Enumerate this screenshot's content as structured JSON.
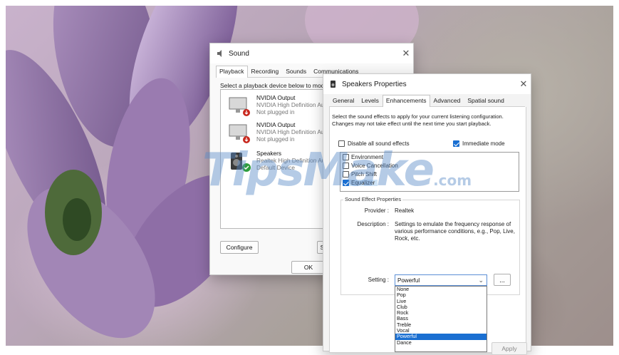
{
  "sound_window": {
    "title": "Sound",
    "close": "✕",
    "tabs": [
      "Playback",
      "Recording",
      "Sounds",
      "Communications"
    ],
    "hint": "Select a playback device below to modi",
    "devices": [
      {
        "name": "NVIDIA Output",
        "line1": "NVIDIA High Definition Au",
        "line2": "Not plugged in"
      },
      {
        "name": "NVIDIA Output",
        "line1": "NVIDIA High Definition Au",
        "line2": "Not plugged in"
      },
      {
        "name": "Speakers",
        "line1": "Realtek High Definition Au",
        "line2": "Default Device"
      }
    ],
    "configure_label": "Configure",
    "set_label": "S",
    "ok_label": "OK"
  },
  "speakers_window": {
    "title": "Speakers Properties",
    "close": "✕",
    "tabs": [
      "General",
      "Levels",
      "Enhancements",
      "Advanced",
      "Spatial sound"
    ],
    "instructions": "Select the sound effects to apply for your current listening configuration. Changes may not take effect until the next time you start playback.",
    "disable_all_label": "Disable all sound effects",
    "disable_all_checked": false,
    "immediate_mode_label": "Immediate mode",
    "immediate_mode_checked": true,
    "effects": [
      {
        "label": "Environment",
        "checked": false
      },
      {
        "label": "Voice Cancellation",
        "checked": false
      },
      {
        "label": "Pitch Shift",
        "checked": false
      },
      {
        "label": "Equalizer",
        "checked": true
      }
    ],
    "properties_title": "Sound Effect Properties",
    "provider_label": "Provider :",
    "provider_value": "Realtek",
    "description_label": "Description :",
    "description_value": "Settings to emulate the frequency response of various performance conditions, e.g., Pop, Live, Rock, etc.",
    "setting_label": "Setting :",
    "setting_value": "Powerful",
    "more_button": "...",
    "setting_options": [
      "None",
      "Pop",
      "Live",
      "Club",
      "Rock",
      "Bass",
      "Treble",
      "Vocal",
      "Powerful",
      "Dance"
    ],
    "selected_option": "Powerful",
    "apply_label": "Apply"
  },
  "watermark": {
    "text": "TipsMake",
    "suffix": ".com"
  },
  "colors": {
    "accent": "#1a6fd1",
    "selection": "#cfe4f7",
    "petal": "#8f6fa3"
  }
}
